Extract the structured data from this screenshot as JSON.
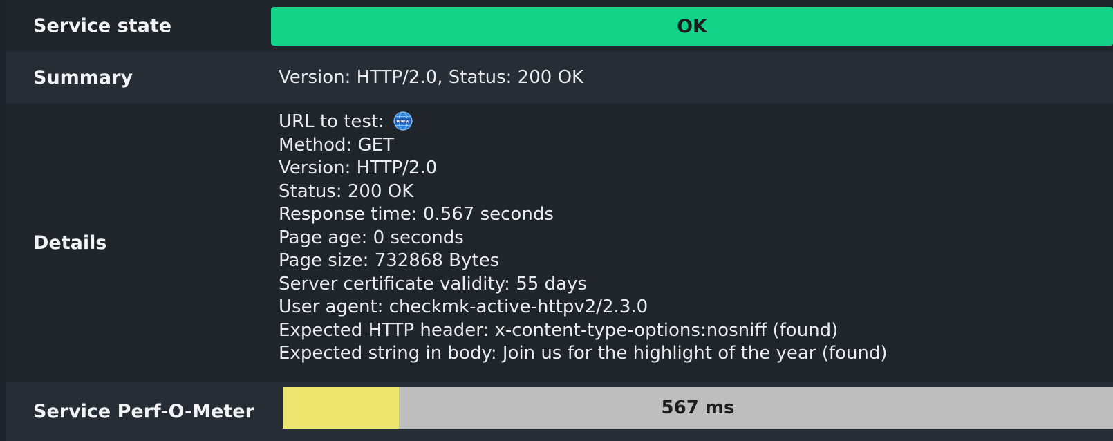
{
  "service_state": {
    "label": "Service state",
    "value": "OK",
    "color": "#13d389"
  },
  "summary": {
    "label": "Summary",
    "value": "Version: HTTP/2.0, Status: 200 OK"
  },
  "details": {
    "label": "Details",
    "url_label": "URL to test:",
    "url_icon": "globe-www-icon",
    "lines": [
      "Method: GET",
      "Version: HTTP/2.0",
      "Status: 200 OK",
      "Response time: 0.567 seconds",
      "Page age: 0 seconds",
      "Page size: 732868 Bytes",
      "Server certificate validity: 55 days",
      "User agent: checkmk-active-httpv2/2.3.0",
      "Expected HTTP header: x-content-type-options:nosniff (found)",
      "Expected string in body: Join us for the highlight of the year (found)"
    ]
  },
  "perf_o_meter": {
    "label": "Service Perf-O-Meter",
    "value_text": "567 ms",
    "fill_fraction": 0.14,
    "fill_color": "#ede66e",
    "bg_color": "#bebebe"
  }
}
